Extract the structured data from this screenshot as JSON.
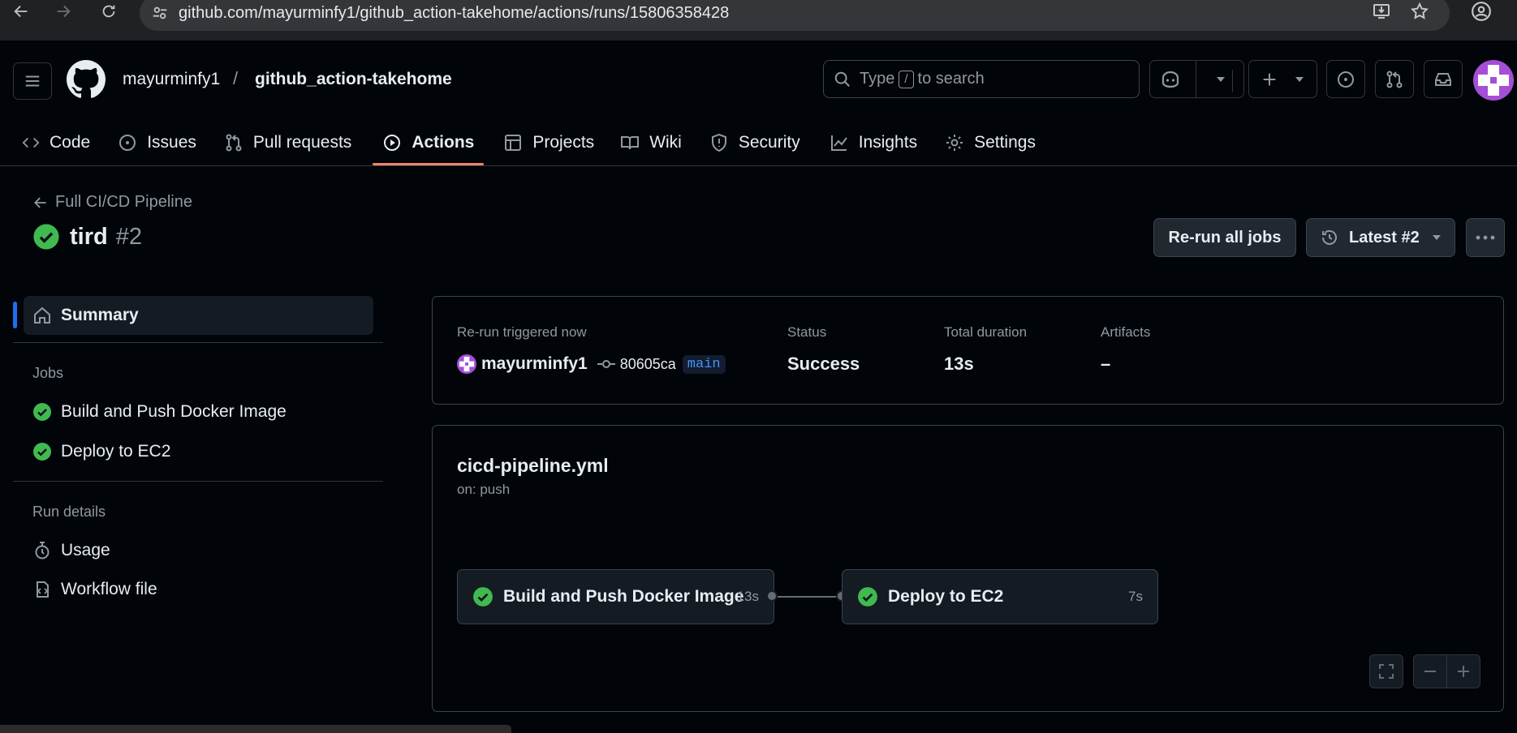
{
  "browser": {
    "url": "github.com/mayurminfy1/github_action-takehome/actions/runs/15806358428"
  },
  "repo": {
    "owner": "mayurminfy1",
    "separator": "/",
    "name": "github_action-takehome"
  },
  "search": {
    "prefix": "Type",
    "key": "/",
    "suffix": "to search"
  },
  "tabs": [
    {
      "label": "Code",
      "icon": "code-icon"
    },
    {
      "label": "Issues",
      "icon": "issue-opened-icon"
    },
    {
      "label": "Pull requests",
      "icon": "git-pull-request-icon"
    },
    {
      "label": "Actions",
      "icon": "play-icon",
      "active": true
    },
    {
      "label": "Projects",
      "icon": "table-icon"
    },
    {
      "label": "Wiki",
      "icon": "book-icon"
    },
    {
      "label": "Security",
      "icon": "shield-icon"
    },
    {
      "label": "Insights",
      "icon": "graph-icon"
    },
    {
      "label": "Settings",
      "icon": "gear-icon"
    }
  ],
  "run": {
    "workflow_link": "Full CI/CD Pipeline",
    "title": "tird",
    "number": "#2",
    "rerun_label": "Re-run all jobs",
    "latest_label": "Latest #2"
  },
  "sidebar": {
    "summary": "Summary",
    "jobs_heading": "Jobs",
    "jobs": [
      "Build and Push Docker Image",
      "Deploy to EC2"
    ],
    "details_heading": "Run details",
    "details": [
      {
        "label": "Usage",
        "icon": "stopwatch-icon"
      },
      {
        "label": "Workflow file",
        "icon": "file-code-icon"
      }
    ]
  },
  "summary": {
    "trigger_label": "Re-run triggered now",
    "actor": "mayurminfy1",
    "commit": "80605ca",
    "branch": "main",
    "status_label": "Status",
    "status_value": "Success",
    "duration_label": "Total duration",
    "duration_value": "13s",
    "artifacts_label": "Artifacts",
    "artifacts_value": "–"
  },
  "graph": {
    "file": "cicd-pipeline.yml",
    "trigger": "on: push",
    "jobs": [
      {
        "name": "Build and Push Docker Image",
        "duration": "13s"
      },
      {
        "name": "Deploy to EC2",
        "duration": "7s"
      }
    ]
  },
  "colors": {
    "accent_underline": "#f78166",
    "success": "#3fb950",
    "link_blue": "#4493f8",
    "avatar_purple": "#a44fd6"
  }
}
